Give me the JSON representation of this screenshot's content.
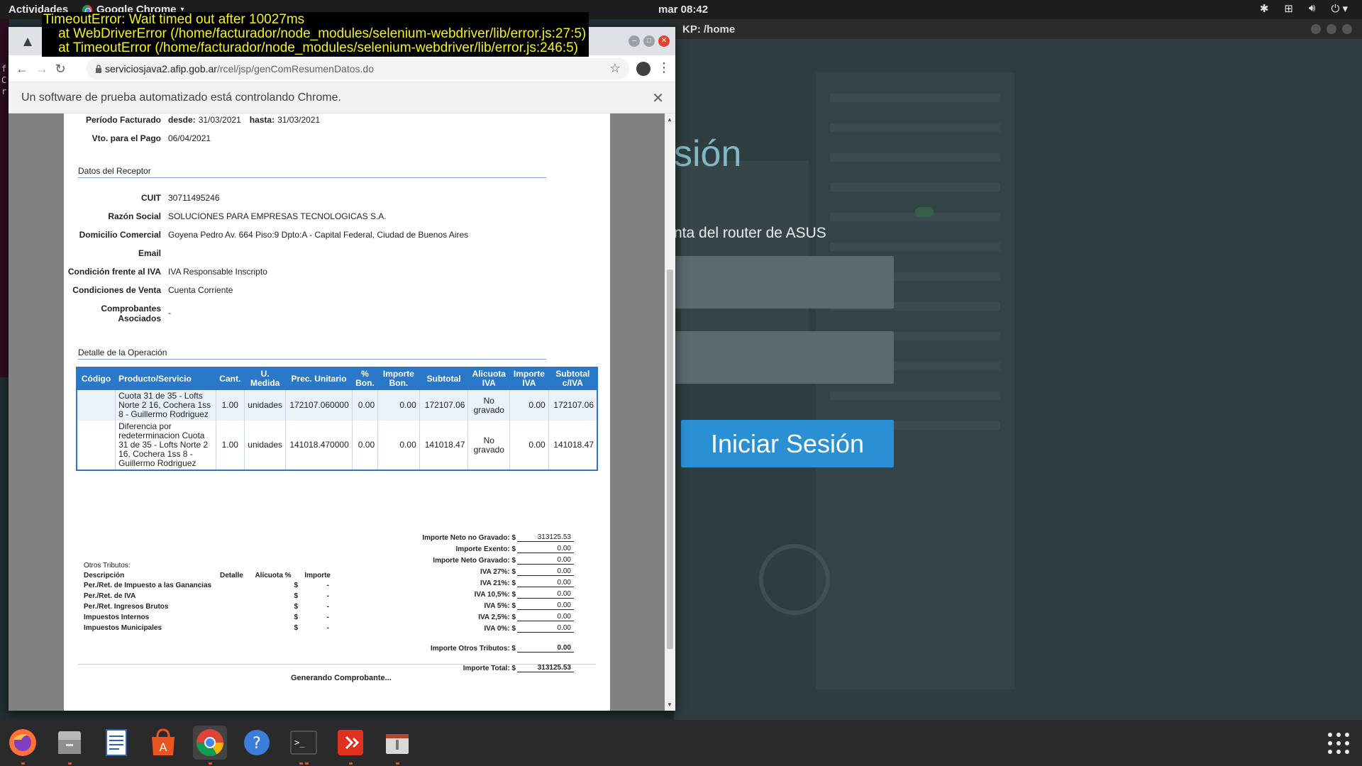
{
  "topbar": {
    "activities": "Actividades",
    "app_menu": "Google Chrome",
    "clock": "mar 08:42"
  },
  "background_window": {
    "title": "KP: /home",
    "heading_fragment": "sión",
    "subtitle_fragment": "nta del router de ASUS",
    "login_button": "Iniciar Sesión"
  },
  "terminal_strip": [
    "f",
    "C",
    "r"
  ],
  "error_overlay": {
    "lines": [
      "TimeoutError: Wait timed out after 10027ms",
      "    at WebDriverError (/home/facturador/node_modules/selenium-webdriver/lib/error.js:27:5)",
      "    at TimeoutError (/home/facturador/node_modules/selenium-webdriver/lib/error.js:246:5)"
    ]
  },
  "chrome": {
    "url_host": "serviciosjava2.afip.gob.ar",
    "url_path": "/rcel/jsp/genComResumenDatos.do",
    "infobar_text": "Un software de prueba automatizado está controlando Chrome.",
    "colors": {
      "header_blue": "#2a79c9",
      "error_text": "#f7f31a"
    }
  },
  "document": {
    "periodo_label": "Período Facturado",
    "desde_label": "desde:",
    "desde_value": "31/03/2021",
    "hasta_label": "hasta:",
    "hasta_value": "31/03/2021",
    "vto_label": "Vto. para el Pago",
    "vto_value": "06/04/2021",
    "receptor_title": "Datos del Receptor",
    "receptor": [
      {
        "label": "CUIT",
        "value": "30711495246"
      },
      {
        "label": "Razón Social",
        "value": "SOLUCIONES PARA EMPRESAS TECNOLOGICAS S.A."
      },
      {
        "label": "Domicilio Comercial",
        "value": "Goyena Pedro Av. 664 Piso:9 Dpto:A - Capital Federal, Ciudad de Buenos Aires"
      },
      {
        "label": "Email",
        "value": ""
      },
      {
        "label": "Condición frente al IVA",
        "value": "IVA Responsable Inscripto"
      },
      {
        "label": "Condiciones de Venta",
        "value": "Cuenta Corriente"
      },
      {
        "label": "Comprobantes Asociados",
        "value": "-"
      }
    ],
    "detalle_title": "Detalle de la Operación",
    "columns": [
      "Código",
      "Producto/Servicio",
      "Cant.",
      "U. Medida",
      "Prec. Unitario",
      "% Bon.",
      "Importe Bon.",
      "Subtotal",
      "Alicuota IVA",
      "Importe IVA",
      "Subtotal c/IVA"
    ],
    "rows": [
      [
        "",
        "Cuota 31 de 35 - Lofts Norte 2 16, Cochera 1ss 8 - Guillermo Rodriguez",
        "1.00",
        "unidades",
        "172107.060000",
        "0.00",
        "0.00",
        "172107.06",
        "No gravado",
        "0.00",
        "172107.06"
      ],
      [
        "",
        "Diferencia por redeterminacion Cuota 31 de 35 - Lofts Norte 2 16, Cochera 1ss 8 - Guillermo Rodriguez",
        "1.00",
        "unidades",
        "141018.470000",
        "0.00",
        "0.00",
        "141018.47",
        "No gravado",
        "0.00",
        "141018.47"
      ]
    ],
    "otros_tributos": {
      "title": "Otros Tributos:",
      "headers": [
        "Descripción",
        "Detalle",
        "Alícuota %",
        "Importe"
      ],
      "rows": [
        [
          "Per./Ret. de Impuesto a las Ganancias",
          "",
          "",
          "$",
          "-"
        ],
        [
          "Per./Ret. de IVA",
          "",
          "",
          "$",
          "-"
        ],
        [
          "Per./Ret. Ingresos Brutos",
          "",
          "",
          "$",
          "-"
        ],
        [
          "Impuestos Internos",
          "",
          "",
          "$",
          "-"
        ],
        [
          "Impuestos Municipales",
          "",
          "",
          "$",
          "-"
        ]
      ]
    },
    "totals": [
      {
        "label": "Importe Neto no Gravado: $",
        "value": "313125.53"
      },
      {
        "label": "Importe Exento: $",
        "value": "0.00"
      },
      {
        "label": "Importe Neto Gravado: $",
        "value": "0.00"
      },
      {
        "label": "IVA 27%: $",
        "value": "0.00"
      },
      {
        "label": "IVA 21%: $",
        "value": "0.00"
      },
      {
        "label": "IVA 10,5%: $",
        "value": "0.00"
      },
      {
        "label": "IVA 5%: $",
        "value": "0.00"
      },
      {
        "label": "IVA 2,5%: $",
        "value": "0.00"
      },
      {
        "label": "IVA 0%: $",
        "value": "0.00"
      }
    ],
    "otros_total_label": "Importe Otros Tributos: $",
    "otros_total_value": "0.00",
    "grand_total_label": "Importe Total: $",
    "grand_total_value": "313125.53",
    "status": "Generando Comprobante..."
  },
  "dock": {
    "apps": [
      "firefox-icon",
      "files-icon",
      "writer-icon",
      "software-icon",
      "chrome-icon",
      "help-icon",
      "terminal-icon",
      "git-icon",
      "archive-icon"
    ]
  }
}
